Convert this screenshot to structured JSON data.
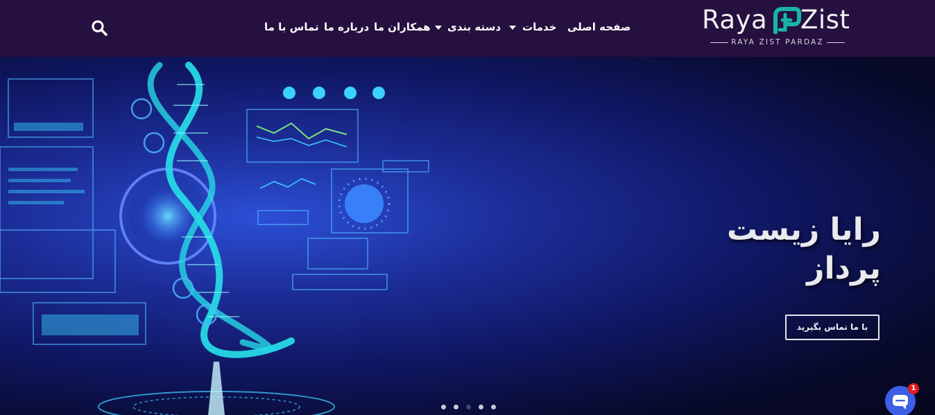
{
  "brand": {
    "name_left": "Raya",
    "name_right": "Zist",
    "tagline": "RAYA ZIST PARDAZ",
    "accent_color": "#18b4a8"
  },
  "nav": {
    "items": [
      {
        "label": "صفحه اصلی",
        "has_dropdown": false
      },
      {
        "label": "خدمات",
        "has_dropdown": true
      },
      {
        "label": "دسته بندی",
        "has_dropdown": true
      },
      {
        "label": "همکاران ما",
        "has_dropdown": false
      },
      {
        "label": "درباره ما",
        "has_dropdown": false
      },
      {
        "label": "تماس با ما",
        "has_dropdown": false
      }
    ],
    "search_icon": "search-icon"
  },
  "hero": {
    "title": "رایا زیست پرداز",
    "cta_label": "با ما تماس بگیرید",
    "slides_count": 5,
    "active_slide": 3
  },
  "chat": {
    "icon": "chat-icon",
    "badge_count": "1"
  },
  "colors": {
    "header_bg": "#25103f",
    "hero_bg": "#0b0b2a",
    "chat_button": "#3c5fe6",
    "badge": "#e21b1b"
  }
}
